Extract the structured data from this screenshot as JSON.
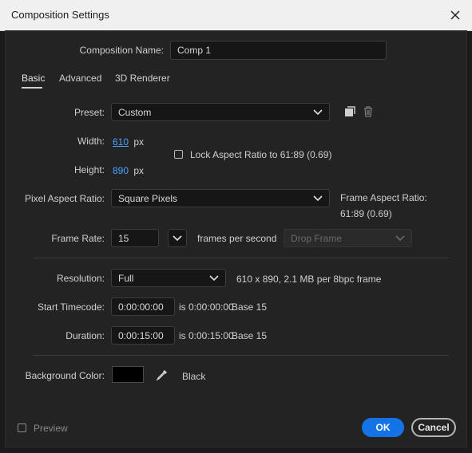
{
  "window": {
    "title": "Composition Settings"
  },
  "comp_name": {
    "label": "Composition Name:",
    "value": "Comp 1"
  },
  "tabs": [
    {
      "label": "Basic",
      "active": true
    },
    {
      "label": "Advanced"
    },
    {
      "label": "3D Renderer"
    }
  ],
  "preset": {
    "label": "Preset:",
    "value": "Custom",
    "icons": [
      "save-preset-icon",
      "trash-icon"
    ]
  },
  "width": {
    "label": "Width:",
    "value": "610",
    "unit": "px"
  },
  "height": {
    "label": "Height:",
    "value": "890",
    "unit": "px"
  },
  "lock_aspect": {
    "label": "Lock Aspect Ratio to 61:89 (0.69)",
    "checked": false
  },
  "pixel_aspect": {
    "label": "Pixel Aspect Ratio:",
    "value": "Square Pixels"
  },
  "frame_aspect": {
    "label": "Frame Aspect Ratio:",
    "value": "61:89 (0.69)"
  },
  "frame_rate": {
    "label": "Frame Rate:",
    "value": "15",
    "unit": "frames per second",
    "drop_frame": "Drop Frame"
  },
  "resolution": {
    "label": "Resolution:",
    "value": "Full",
    "info": "610 x 890, 2.1 MB per 8bpc frame"
  },
  "start_timecode": {
    "label": "Start Timecode:",
    "value": "0:00:00:00",
    "info": "is 0:00:00:00",
    "base": "Base 15"
  },
  "duration": {
    "label": "Duration:",
    "value": "0:00:15:00",
    "info": "is 0:00:15:00",
    "base": "Base 15"
  },
  "background": {
    "label": "Background Color:",
    "name": "Black",
    "color": "#000000"
  },
  "footer": {
    "preview_label": "Preview",
    "ok_label": "OK",
    "cancel_label": "Cancel"
  },
  "colors": {
    "accent": "#1473e6",
    "link": "#4aa0ff",
    "panel": "#232323"
  }
}
